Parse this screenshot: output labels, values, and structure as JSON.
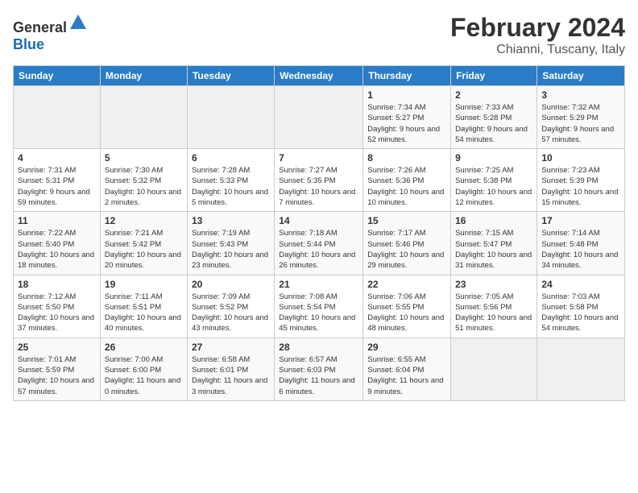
{
  "header": {
    "logo_general": "General",
    "logo_blue": "Blue",
    "month": "February 2024",
    "location": "Chianni, Tuscany, Italy"
  },
  "weekdays": [
    "Sunday",
    "Monday",
    "Tuesday",
    "Wednesday",
    "Thursday",
    "Friday",
    "Saturday"
  ],
  "weeks": [
    [
      {
        "day": "",
        "info": ""
      },
      {
        "day": "",
        "info": ""
      },
      {
        "day": "",
        "info": ""
      },
      {
        "day": "",
        "info": ""
      },
      {
        "day": "1",
        "info": "Sunrise: 7:34 AM\nSunset: 5:27 PM\nDaylight: 9 hours and 52 minutes."
      },
      {
        "day": "2",
        "info": "Sunrise: 7:33 AM\nSunset: 5:28 PM\nDaylight: 9 hours and 54 minutes."
      },
      {
        "day": "3",
        "info": "Sunrise: 7:32 AM\nSunset: 5:29 PM\nDaylight: 9 hours and 57 minutes."
      }
    ],
    [
      {
        "day": "4",
        "info": "Sunrise: 7:31 AM\nSunset: 5:31 PM\nDaylight: 9 hours and 59 minutes."
      },
      {
        "day": "5",
        "info": "Sunrise: 7:30 AM\nSunset: 5:32 PM\nDaylight: 10 hours and 2 minutes."
      },
      {
        "day": "6",
        "info": "Sunrise: 7:28 AM\nSunset: 5:33 PM\nDaylight: 10 hours and 5 minutes."
      },
      {
        "day": "7",
        "info": "Sunrise: 7:27 AM\nSunset: 5:35 PM\nDaylight: 10 hours and 7 minutes."
      },
      {
        "day": "8",
        "info": "Sunrise: 7:26 AM\nSunset: 5:36 PM\nDaylight: 10 hours and 10 minutes."
      },
      {
        "day": "9",
        "info": "Sunrise: 7:25 AM\nSunset: 5:38 PM\nDaylight: 10 hours and 12 minutes."
      },
      {
        "day": "10",
        "info": "Sunrise: 7:23 AM\nSunset: 5:39 PM\nDaylight: 10 hours and 15 minutes."
      }
    ],
    [
      {
        "day": "11",
        "info": "Sunrise: 7:22 AM\nSunset: 5:40 PM\nDaylight: 10 hours and 18 minutes."
      },
      {
        "day": "12",
        "info": "Sunrise: 7:21 AM\nSunset: 5:42 PM\nDaylight: 10 hours and 20 minutes."
      },
      {
        "day": "13",
        "info": "Sunrise: 7:19 AM\nSunset: 5:43 PM\nDaylight: 10 hours and 23 minutes."
      },
      {
        "day": "14",
        "info": "Sunrise: 7:18 AM\nSunset: 5:44 PM\nDaylight: 10 hours and 26 minutes."
      },
      {
        "day": "15",
        "info": "Sunrise: 7:17 AM\nSunset: 5:46 PM\nDaylight: 10 hours and 29 minutes."
      },
      {
        "day": "16",
        "info": "Sunrise: 7:15 AM\nSunset: 5:47 PM\nDaylight: 10 hours and 31 minutes."
      },
      {
        "day": "17",
        "info": "Sunrise: 7:14 AM\nSunset: 5:48 PM\nDaylight: 10 hours and 34 minutes."
      }
    ],
    [
      {
        "day": "18",
        "info": "Sunrise: 7:12 AM\nSunset: 5:50 PM\nDaylight: 10 hours and 37 minutes."
      },
      {
        "day": "19",
        "info": "Sunrise: 7:11 AM\nSunset: 5:51 PM\nDaylight: 10 hours and 40 minutes."
      },
      {
        "day": "20",
        "info": "Sunrise: 7:09 AM\nSunset: 5:52 PM\nDaylight: 10 hours and 43 minutes."
      },
      {
        "day": "21",
        "info": "Sunrise: 7:08 AM\nSunset: 5:54 PM\nDaylight: 10 hours and 45 minutes."
      },
      {
        "day": "22",
        "info": "Sunrise: 7:06 AM\nSunset: 5:55 PM\nDaylight: 10 hours and 48 minutes."
      },
      {
        "day": "23",
        "info": "Sunrise: 7:05 AM\nSunset: 5:56 PM\nDaylight: 10 hours and 51 minutes."
      },
      {
        "day": "24",
        "info": "Sunrise: 7:03 AM\nSunset: 5:58 PM\nDaylight: 10 hours and 54 minutes."
      }
    ],
    [
      {
        "day": "25",
        "info": "Sunrise: 7:01 AM\nSunset: 5:59 PM\nDaylight: 10 hours and 57 minutes."
      },
      {
        "day": "26",
        "info": "Sunrise: 7:00 AM\nSunset: 6:00 PM\nDaylight: 11 hours and 0 minutes."
      },
      {
        "day": "27",
        "info": "Sunrise: 6:58 AM\nSunset: 6:01 PM\nDaylight: 11 hours and 3 minutes."
      },
      {
        "day": "28",
        "info": "Sunrise: 6:57 AM\nSunset: 6:03 PM\nDaylight: 11 hours and 6 minutes."
      },
      {
        "day": "29",
        "info": "Sunrise: 6:55 AM\nSunset: 6:04 PM\nDaylight: 11 hours and 9 minutes."
      },
      {
        "day": "",
        "info": ""
      },
      {
        "day": "",
        "info": ""
      }
    ]
  ]
}
